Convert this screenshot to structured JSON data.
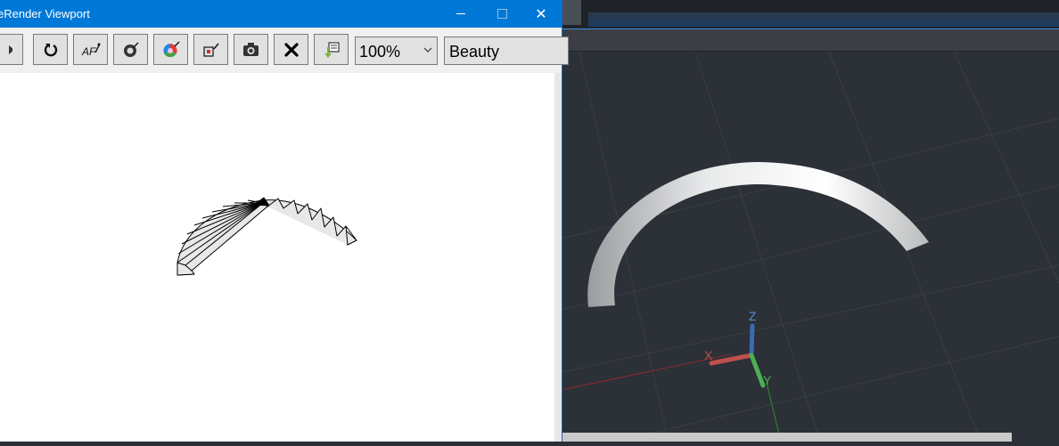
{
  "window": {
    "title": "eRender Viewport",
    "minimize_glyph": "—",
    "close_glyph": "✕"
  },
  "toolbar": {
    "buttons": [
      {
        "icon": "play-icon",
        "tooltip": ""
      },
      {
        "icon": "refresh-icon"
      },
      {
        "icon": "af-region-icon"
      },
      {
        "icon": "render-settings-icon"
      },
      {
        "icon": "color-wheel-icon"
      },
      {
        "icon": "region-select-icon"
      },
      {
        "icon": "camera-snapshot-icon"
      },
      {
        "icon": "stop-close-icon"
      },
      {
        "icon": "export-image-icon"
      }
    ],
    "zoom": {
      "value": "100%"
    },
    "render_mode": {
      "value": "Beauty"
    }
  },
  "axis_gizmo": {
    "x_label": "X",
    "y_label": "Y",
    "z_label": "Z",
    "x_color": "#c0504d",
    "y_color": "#4caf50",
    "z_color": "#3d6bb3"
  },
  "colors": {
    "titlebar": "#0078d7",
    "viewport_bg": "#2c3037"
  }
}
